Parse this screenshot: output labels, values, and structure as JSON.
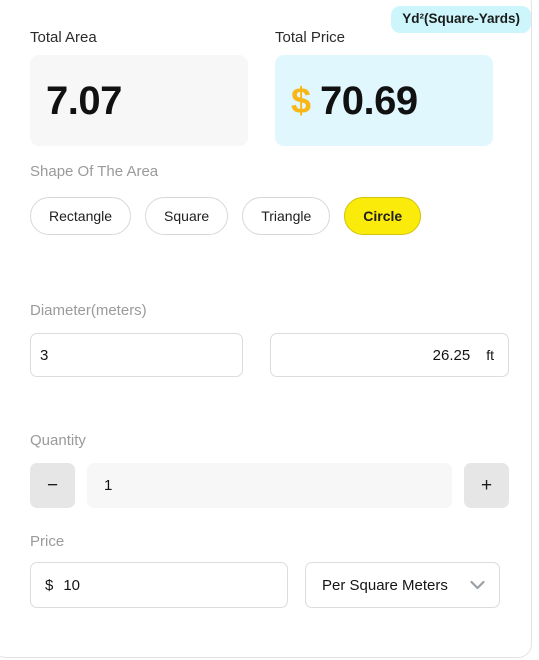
{
  "unit_badge": {
    "label": "Yd²(Square-Yards)",
    "bg_color": "#ccf6fb"
  },
  "totals": {
    "area": {
      "label": "Total Area",
      "value": "7.07",
      "bg_color": "#f7f7f7"
    },
    "price": {
      "label": "Total Price",
      "currency": "$",
      "value": "70.69",
      "bg_color": "#e0f7fd",
      "currency_color": "#f9b717"
    }
  },
  "shape": {
    "label": "Shape Of The Area",
    "options": [
      {
        "label": "Rectangle",
        "selected": false
      },
      {
        "label": "Square",
        "selected": false
      },
      {
        "label": "Triangle",
        "selected": false
      },
      {
        "label": "Circle",
        "selected": true
      }
    ],
    "selected_color": "#faeb0b"
  },
  "dimension": {
    "label": "Diameter(meters)",
    "input_value": "3",
    "converted_value": "26.25",
    "converted_unit": "ft"
  },
  "quantity": {
    "label": "Quantity",
    "value": "1",
    "decrement_label": "−",
    "increment_label": "+"
  },
  "price": {
    "label": "Price",
    "currency": "$",
    "value": "10",
    "unit_basis": "Per Square Meters"
  }
}
